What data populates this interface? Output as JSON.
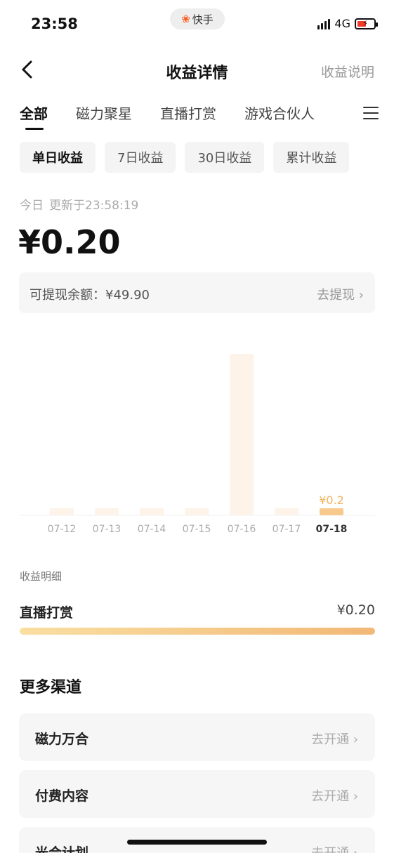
{
  "status_bar": {
    "time": "23:58",
    "app_name": "快手",
    "network": "4G"
  },
  "nav": {
    "title": "收益详情",
    "action": "收益说明"
  },
  "category_tabs": [
    {
      "label": "全部",
      "active": true
    },
    {
      "label": "磁力聚星",
      "active": false
    },
    {
      "label": "直播打赏",
      "active": false
    },
    {
      "label": "游戏合伙人",
      "active": false
    }
  ],
  "period_chips": [
    {
      "label": "单日收益",
      "active": true
    },
    {
      "label": "7日收益",
      "active": false
    },
    {
      "label": "30日收益",
      "active": false
    },
    {
      "label": "累计收益",
      "active": false
    }
  ],
  "summary": {
    "day_label": "今日",
    "updated": "更新于23:58:19",
    "amount": "¥0.20",
    "balance": "可提现余额：¥49.90",
    "withdraw": "去提现 ›"
  },
  "chart_data": {
    "type": "bar",
    "categories": [
      "07-12",
      "07-13",
      "07-14",
      "07-15",
      "07-16",
      "07-17",
      "07-18"
    ],
    "values": [
      0,
      0,
      0,
      0,
      27,
      0,
      0.2
    ],
    "highlight_index": 6,
    "highlight_label": "¥0.2",
    "colors": {
      "bar": "#fdf3e8",
      "highlight": "#f7c98c",
      "highlight_label": "#f2b35e"
    }
  },
  "detail": {
    "header": "收益明细",
    "rows": [
      {
        "name": "直播打赏",
        "value": "¥0.20",
        "share": 1.0
      }
    ]
  },
  "more_channels": {
    "title": "更多渠道",
    "items": [
      {
        "name": "磁力万合",
        "action": "去开通 ›"
      },
      {
        "name": "付费内容",
        "action": "去开通 ›"
      },
      {
        "name": "光合计划",
        "action": "去开通 ›"
      }
    ]
  }
}
